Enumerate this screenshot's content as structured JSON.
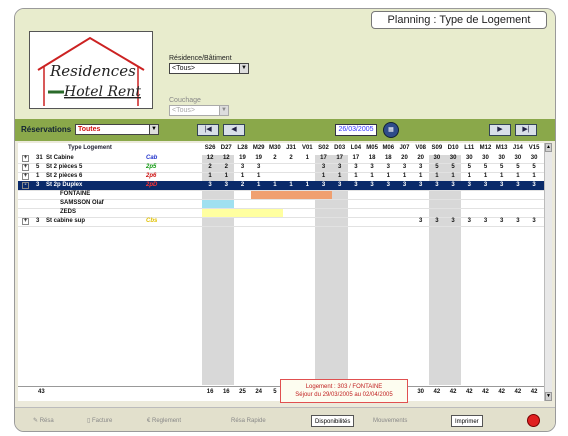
{
  "header": {
    "title": "Planning : Type de Logement"
  },
  "logo": {
    "line1": "Residences",
    "line2": "Hotel Rent"
  },
  "filters": {
    "building_label": "Résidence/Bâtiment",
    "building_value": "<Tous>",
    "bedding_label": "Couchage",
    "bedding_value": "<Tous>"
  },
  "reservations": {
    "label": "Réservations",
    "value": "Toutes",
    "date": "26/03/2005"
  },
  "grid": {
    "type_header": "Type Logement",
    "days": [
      "S26",
      "D27",
      "L28",
      "M29",
      "M30",
      "J31",
      "V01",
      "S02",
      "D03",
      "L04",
      "M05",
      "M06",
      "J07",
      "V08",
      "S09",
      "D10",
      "L11",
      "M12",
      "M13",
      "J14",
      "V15"
    ],
    "rows": [
      {
        "expand": "+",
        "count": "31",
        "name": "St Cabine",
        "code": "Cab",
        "code_color": "#2233cc",
        "values": [
          "12",
          "12",
          "19",
          "19",
          "2",
          "2",
          "1",
          "17",
          "17",
          "17",
          "18",
          "18",
          "20",
          "20",
          "30",
          "30",
          "30",
          "30",
          "30",
          "30",
          "30"
        ]
      },
      {
        "expand": "+",
        "count": "5",
        "name": "St 2 pièces 5",
        "code": "2p5",
        "code_color": "#119911",
        "values": [
          "2",
          "2",
          "3",
          "3",
          "",
          "",
          "",
          "3",
          "3",
          "3",
          "3",
          "3",
          "3",
          "3",
          "5",
          "5",
          "5",
          "5",
          "5",
          "5",
          "5"
        ]
      },
      {
        "expand": "+",
        "count": "1",
        "name": "St 2 pièces 6",
        "code": "2p6",
        "code_color": "#cc1111",
        "values": [
          "1",
          "1",
          "1",
          "1",
          "",
          "",
          "",
          "1",
          "1",
          "1",
          "1",
          "1",
          "1",
          "1",
          "1",
          "1",
          "1",
          "1",
          "1",
          "1",
          "1"
        ]
      },
      {
        "expand": "-",
        "count": "3",
        "name": "St 2p Duplex",
        "code": "2pD",
        "code_color": "#ff3333",
        "values": [
          "3",
          "3",
          "2",
          "1",
          "1",
          "1",
          "1",
          "3",
          "3",
          "3",
          "3",
          "3",
          "3",
          "3",
          "3",
          "3",
          "3",
          "3",
          "3",
          "3",
          "3"
        ],
        "selected": true
      },
      {
        "name": "FONTAINE",
        "sub": true
      },
      {
        "name": "SAMSSON Olaf",
        "sub": true
      },
      {
        "name": "ZEDS",
        "sub": true
      },
      {
        "expand": "+",
        "count": "3",
        "name": "St cabine sup",
        "code": "Cbs",
        "code_color": "#e0c000",
        "values": [
          "",
          "",
          "",
          "",
          "",
          "",
          "",
          "",
          "",
          "",
          "",
          "",
          "",
          "3",
          "3",
          "3",
          "3",
          "3",
          "3",
          "3",
          "3"
        ]
      }
    ],
    "totals_count": "43",
    "totals": [
      "16",
      "16",
      "25",
      "24",
      "5",
      "5",
      "4",
      "37",
      "37",
      "37",
      "28",
      "28",
      "30",
      "30",
      "42",
      "42",
      "42",
      "42",
      "42",
      "42",
      "42"
    ]
  },
  "tooltip": {
    "line1": "Logement : 303 / FONTAINE",
    "line2": "Séjour du 29/03/2005 au 02/04/2005"
  },
  "footer": {
    "resa": "Résa",
    "facture": "Facture",
    "reglement": "Reglement",
    "resa_rapide": "Résa Rapide",
    "disponibilites": "Disponibilités",
    "mouvements": "Mouvements",
    "imprimer": "Imprimer"
  }
}
